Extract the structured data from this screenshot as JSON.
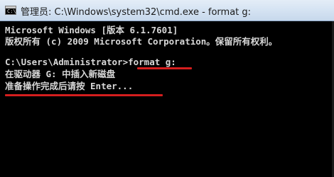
{
  "window": {
    "title": "管理员: C:\\Windows\\system32\\cmd.exe - format  g:"
  },
  "console": {
    "lines": [
      "Microsoft Windows [版本 6.1.7601]",
      "版权所有 (c) 2009 Microsoft Corporation。保留所有权利。",
      "C:\\Users\\Administrator>format g:",
      "在驱动器 G: 中插入新磁盘",
      "准备操作完成后请按 Enter..."
    ]
  },
  "colors": {
    "console_bg": "#000000",
    "console_text": "#d8d8d8",
    "annotation_underline": "#d51e1e",
    "titlebar": "#d6e4f3"
  },
  "icons": {
    "app_icon": "cmd-icon"
  }
}
